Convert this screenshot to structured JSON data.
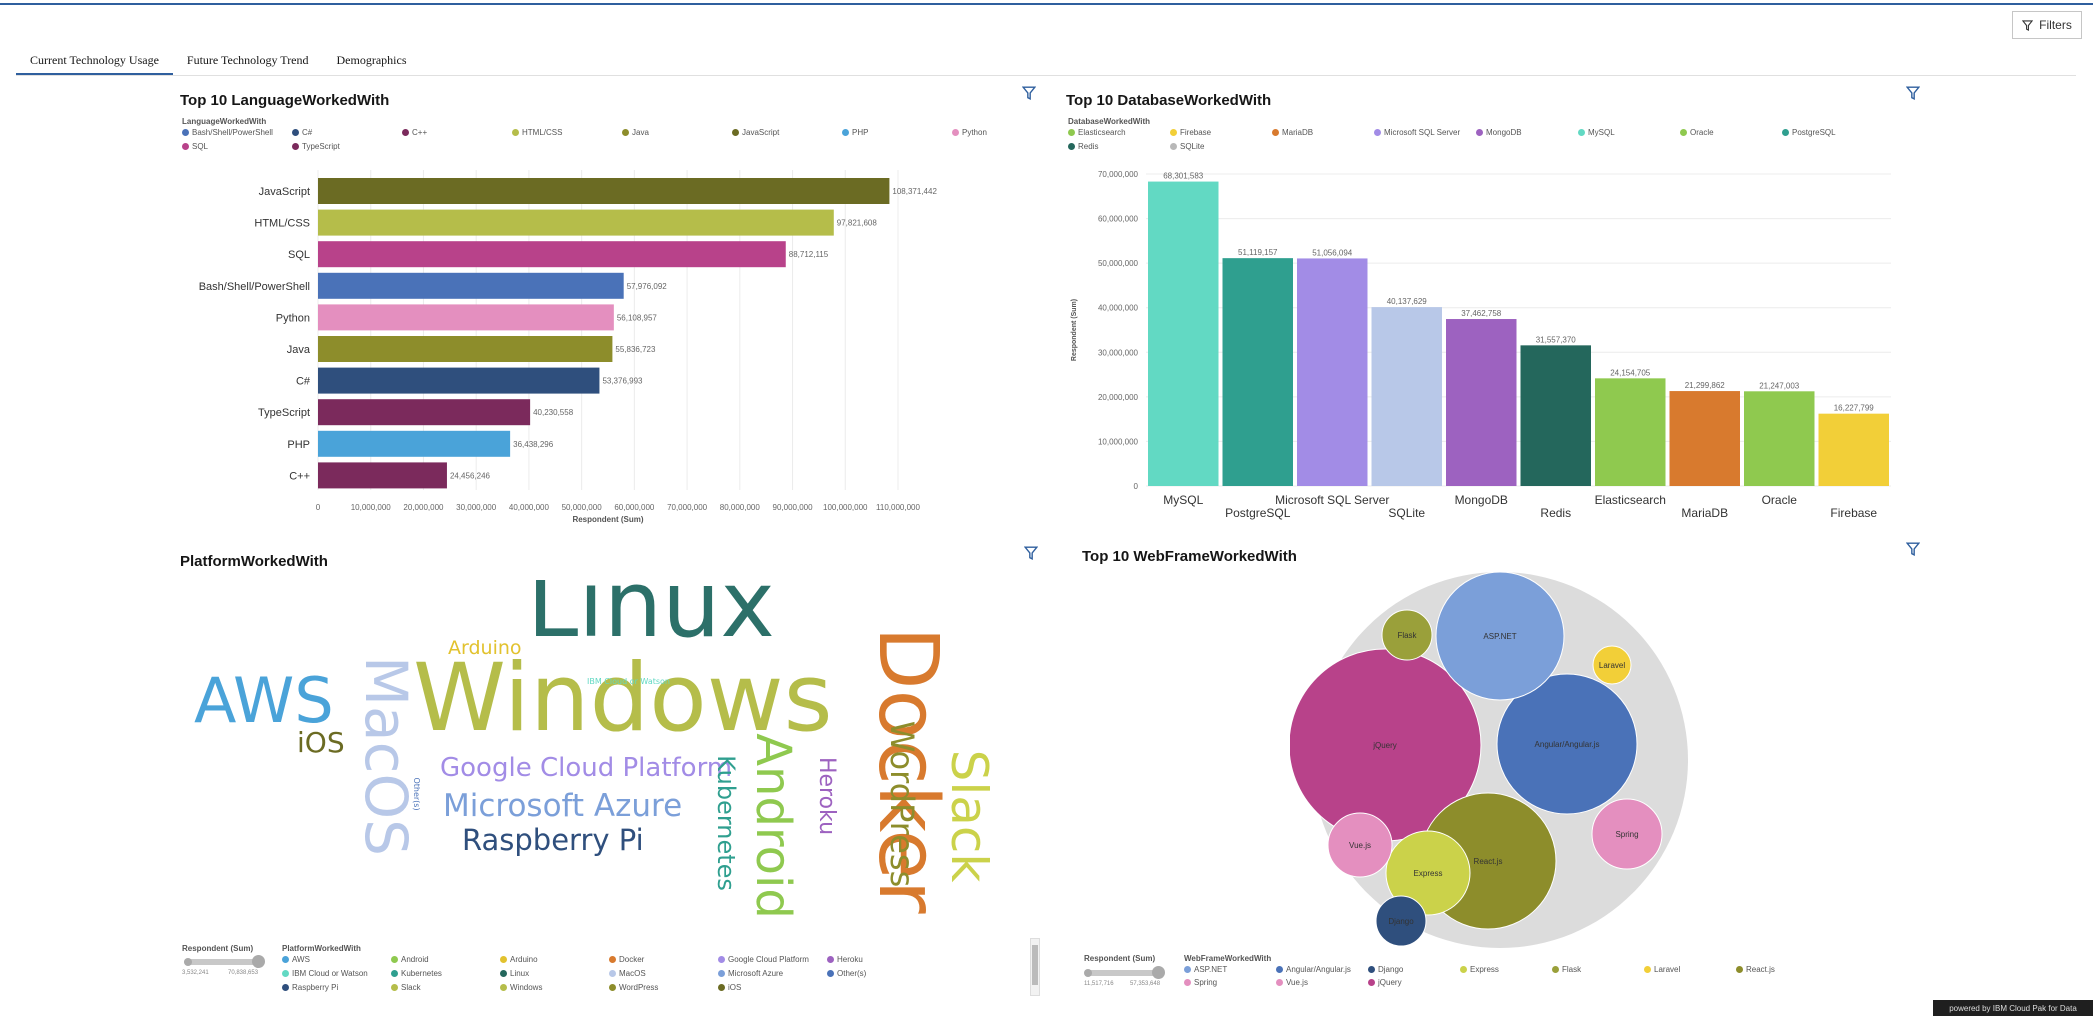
{
  "toolbar": {
    "filters_label": "Filters"
  },
  "tabs": [
    {
      "label": "Current Technology Usage"
    },
    {
      "label": "Future Technology Trend"
    },
    {
      "label": "Demographics"
    }
  ],
  "lang_panel": {
    "title": "Top 10 LanguageWorkedWith",
    "legend_title": "LanguageWorkedWith",
    "legend": [
      {
        "label": "Bash/Shell/PowerShell",
        "color": "#4a72b8"
      },
      {
        "label": "C#",
        "color": "#2f4f7d"
      },
      {
        "label": "C++",
        "color": "#7b2a5c"
      },
      {
        "label": "HTML/CSS",
        "color": "#b5bd4a"
      },
      {
        "label": "Java",
        "color": "#8d8d2b"
      },
      {
        "label": "JavaScript",
        "color": "#6b6b23"
      },
      {
        "label": "PHP",
        "color": "#4aa3d9"
      },
      {
        "label": "Python",
        "color": "#e48fbf"
      },
      {
        "label": "SQL",
        "color": "#b8428a"
      },
      {
        "label": "TypeScript",
        "color": "#7b2a5c"
      }
    ]
  },
  "db_panel": {
    "title": "Top 10 DatabaseWorkedWith",
    "legend_title": "DatabaseWorkedWith",
    "legend": [
      {
        "label": "Elasticsearch",
        "color": "#8fc94f"
      },
      {
        "label": "Firebase",
        "color": "#f2cf38"
      },
      {
        "label": "MariaDB",
        "color": "#d87a2e"
      },
      {
        "label": "Microsoft SQL Server",
        "color": "#a28ce6"
      },
      {
        "label": "MongoDB",
        "color": "#9d62c0"
      },
      {
        "label": "MySQL",
        "color": "#62d9c3"
      },
      {
        "label": "Oracle",
        "color": "#8fc94f"
      },
      {
        "label": "PostgreSQL",
        "color": "#2f9f8f"
      },
      {
        "label": "Redis",
        "color": "#24675c"
      },
      {
        "label": "SQLite",
        "color": "#b8b8b8"
      }
    ]
  },
  "platform_panel": {
    "title": "PlatformWorkedWith",
    "size_legend_title": "Respondent (Sum)",
    "size_min": "3,532,241",
    "size_max": "70,838,653",
    "legend_title": "PlatformWorkedWith",
    "legend": [
      {
        "label": "AWS",
        "color": "#4aa3d9"
      },
      {
        "label": "Android",
        "color": "#8fc94f"
      },
      {
        "label": "Arduino",
        "color": "#e2c22e"
      },
      {
        "label": "Docker",
        "color": "#d87a2e"
      },
      {
        "label": "Google Cloud Platform",
        "color": "#a28ce6"
      },
      {
        "label": "Heroku",
        "color": "#9d62c0"
      },
      {
        "label": "IBM Cloud or Watson",
        "color": "#62d9c3"
      },
      {
        "label": "Kubernetes",
        "color": "#2f9f8f"
      },
      {
        "label": "Linux",
        "color": "#24675c"
      },
      {
        "label": "MacOS",
        "color": "#b8c8e8"
      },
      {
        "label": "Microsoft Azure",
        "color": "#7b9fd9"
      },
      {
        "label": "Other(s)",
        "color": "#4a72b8"
      },
      {
        "label": "Raspberry Pi",
        "color": "#2f4f7d"
      },
      {
        "label": "Slack",
        "color": "#b5bd4a"
      },
      {
        "label": "Windows",
        "color": "#b5bd4a"
      },
      {
        "label": "WordPress",
        "color": "#8d8d2b"
      },
      {
        "label": "iOS",
        "color": "#6b6b23"
      }
    ],
    "words": [
      {
        "text": "Linux",
        "color": "#2c7069"
      },
      {
        "text": "Windows",
        "color": "#b5bd4a"
      },
      {
        "text": "Docker",
        "color": "#d87a2e"
      },
      {
        "text": "AWS",
        "color": "#4aa3d9"
      },
      {
        "text": "MacOS",
        "color": "#b8c8e8"
      },
      {
        "text": "Android",
        "color": "#8fc94f"
      },
      {
        "text": "Slack",
        "color": "#cbd24a"
      },
      {
        "text": "WordPress",
        "color": "#8d8d2b"
      },
      {
        "text": "Google Cloud Platform",
        "color": "#a28ce6"
      },
      {
        "text": "Microsoft Azure",
        "color": "#7b9fd9"
      },
      {
        "text": "Raspberry Pi",
        "color": "#2f4f7d"
      },
      {
        "text": "Kubernetes",
        "color": "#2f9f8f"
      },
      {
        "text": "Heroku",
        "color": "#9d62c0"
      },
      {
        "text": "iOS",
        "color": "#6b6b23"
      },
      {
        "text": "Arduino",
        "color": "#e2c22e"
      },
      {
        "text": "IBM Cloud or Watson",
        "color": "#62d9c3"
      },
      {
        "text": "Other(s)",
        "color": "#4a72b8"
      }
    ]
  },
  "web_panel": {
    "title": "Top 10 WebFrameWorkedWith",
    "size_legend_title": "Respondent (Sum)",
    "size_min": "11,517,716",
    "size_max": "57,353,648",
    "legend_title": "WebFrameWorkedWith",
    "legend": [
      {
        "label": "ASP.NET",
        "color": "#7b9fd9"
      },
      {
        "label": "Angular/Angular.js",
        "color": "#4a72b8"
      },
      {
        "label": "Django",
        "color": "#2f4f7d"
      },
      {
        "label": "Express",
        "color": "#cbd24a"
      },
      {
        "label": "Flask",
        "color": "#9aa03a"
      },
      {
        "label": "Laravel",
        "color": "#f2cf38"
      },
      {
        "label": "React.js",
        "color": "#8d8d2b"
      },
      {
        "label": "Spring",
        "color": "#e48fbf"
      },
      {
        "label": "Vue.js",
        "color": "#e48fbf"
      },
      {
        "label": "jQuery",
        "color": "#b8428a"
      }
    ],
    "bubbles": [
      {
        "label": "jQuery",
        "color": "#b8428a"
      },
      {
        "label": "Angular/Angular.js",
        "color": "#4a72b8"
      },
      {
        "label": "React.js",
        "color": "#8d8d2b"
      },
      {
        "label": "ASP.NET",
        "color": "#7b9fd9"
      },
      {
        "label": "Express",
        "color": "#cbd24a"
      },
      {
        "label": "Spring",
        "color": "#e48fbf"
      },
      {
        "label": "Vue.js",
        "color": "#e48fbf"
      },
      {
        "label": "Flask",
        "color": "#9aa03a"
      },
      {
        "label": "Django",
        "color": "#2f4f7d"
      },
      {
        "label": "Laravel",
        "color": "#f2cf38"
      }
    ]
  },
  "footer": {
    "powered": "powered by IBM Cloud Pak for Data"
  },
  "chart_data": [
    {
      "type": "bar",
      "orientation": "horizontal",
      "title": "Top 10 LanguageWorkedWith",
      "xlabel": "Respondent (Sum)",
      "xlim": [
        0,
        110000000
      ],
      "xticks": [
        "0",
        "10,000,000",
        "20,000,000",
        "30,000,000",
        "40,000,000",
        "50,000,000",
        "60,000,000",
        "70,000,000",
        "80,000,000",
        "90,000,000",
        "100,000,000",
        "110,000,000"
      ],
      "categories": [
        "JavaScript",
        "HTML/CSS",
        "SQL",
        "Bash/Shell/PowerShell",
        "Python",
        "Java",
        "C#",
        "TypeScript",
        "PHP",
        "C++"
      ],
      "values": [
        108371442,
        97821608,
        88712115,
        57976092,
        56108957,
        55836723,
        53376993,
        40230558,
        36438296,
        24456246
      ],
      "value_labels": [
        "108,371,442",
        "97,821,608",
        "88,712,115",
        "57,976,092",
        "56,108,957",
        "55,836,723",
        "53,376,993",
        "40,230,558",
        "36,438,296",
        "24,456,246"
      ],
      "colors": [
        "#6b6b23",
        "#b5bd4a",
        "#b8428a",
        "#4a72b8",
        "#e48fbf",
        "#8d8d2b",
        "#2f4f7d",
        "#7b2a5c",
        "#4aa3d9",
        "#7b2a5c"
      ]
    },
    {
      "type": "bar",
      "title": "Top 10 DatabaseWorkedWith",
      "ylabel": "Respondent (Sum)",
      "ylim": [
        0,
        70000000
      ],
      "yticks": [
        "0",
        "10,000,000",
        "20,000,000",
        "30,000,000",
        "40,000,000",
        "50,000,000",
        "60,000,000",
        "70,000,000"
      ],
      "categories": [
        "MySQL",
        "PostgreSQL",
        "Microsoft SQL Server",
        "SQLite",
        "MongoDB",
        "Redis",
        "Elasticsearch",
        "MariaDB",
        "Oracle",
        "Firebase"
      ],
      "values": [
        68301583,
        51119157,
        51056094,
        40137629,
        37462758,
        31557370,
        24154705,
        21299862,
        21247003,
        16227799
      ],
      "value_labels": [
        "68,301,583",
        "51,119,157",
        "51,056,094",
        "40,137,629",
        "37,462,758",
        "31,557,370",
        "24,154,705",
        "21,299,862",
        "21,247,003",
        "16,227,799"
      ],
      "colors": [
        "#62d9c3",
        "#2f9f8f",
        "#a28ce6",
        "#b8c8e8",
        "#9d62c0",
        "#24675c",
        "#8fc94f",
        "#d87a2e",
        "#8fc94f",
        "#f2cf38"
      ]
    }
  ]
}
